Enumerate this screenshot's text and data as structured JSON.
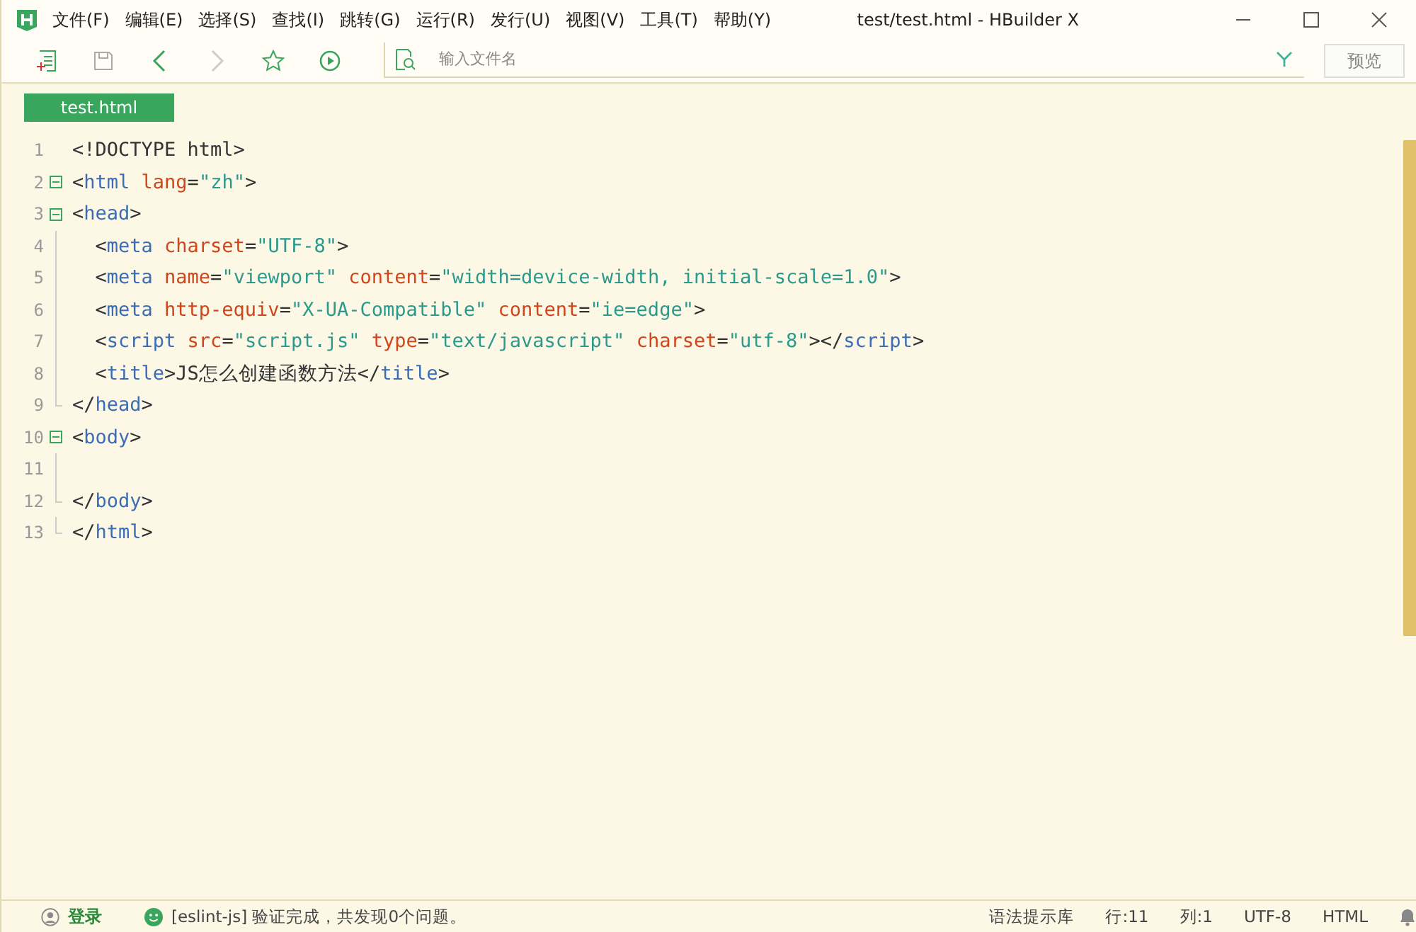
{
  "window": {
    "title": "test/test.html - HBuilder X"
  },
  "menu": [
    "文件(F)",
    "编辑(E)",
    "选择(S)",
    "查找(I)",
    "跳转(G)",
    "运行(R)",
    "发行(U)",
    "视图(V)",
    "工具(T)",
    "帮助(Y)"
  ],
  "toolbar": {
    "search": {
      "placeholder": "输入文件名"
    },
    "preview_button": "预览"
  },
  "tabs": [
    {
      "label": "test.html",
      "selected": true
    }
  ],
  "editor": {
    "lines": [
      {
        "number": "1",
        "kind": "plain",
        "tokens": [
          {
            "kind": "punct",
            "text": "<!DOCTYPE html>"
          }
        ]
      },
      {
        "number": "2",
        "kind": "foldable",
        "tokens": [
          {
            "kind": "punct",
            "text": "<"
          },
          {
            "kind": "tag",
            "text": "html"
          },
          {
            "kind": "attr",
            "text": " lang"
          },
          {
            "kind": "punct",
            "text": "="
          },
          {
            "kind": "str",
            "text": "\"zh\""
          },
          {
            "kind": "punct",
            "text": ">"
          }
        ]
      },
      {
        "number": "3",
        "kind": "foldable",
        "tokens": [
          {
            "kind": "punct",
            "text": "<"
          },
          {
            "kind": "tag",
            "text": "head"
          },
          {
            "kind": "punct",
            "text": ">"
          }
        ]
      },
      {
        "number": "4",
        "kind": "nested",
        "tokens": [
          {
            "kind": "punct",
            "text": "  <"
          },
          {
            "kind": "tag",
            "text": "meta"
          },
          {
            "kind": "attr",
            "text": " charset"
          },
          {
            "kind": "punct",
            "text": "="
          },
          {
            "kind": "str",
            "text": "\"UTF-8\""
          },
          {
            "kind": "punct",
            "text": ">"
          }
        ]
      },
      {
        "number": "5",
        "kind": "nested",
        "tokens": [
          {
            "kind": "punct",
            "text": "  <"
          },
          {
            "kind": "tag",
            "text": "meta"
          },
          {
            "kind": "attr",
            "text": " name"
          },
          {
            "kind": "punct",
            "text": "="
          },
          {
            "kind": "str",
            "text": "\"viewport\""
          },
          {
            "kind": "attr",
            "text": " content"
          },
          {
            "kind": "punct",
            "text": "="
          },
          {
            "kind": "str",
            "text": "\"width=device-width, initial-scale=1.0\""
          },
          {
            "kind": "punct",
            "text": ">"
          }
        ]
      },
      {
        "number": "6",
        "kind": "nested",
        "tokens": [
          {
            "kind": "punct",
            "text": "  <"
          },
          {
            "kind": "tag",
            "text": "meta"
          },
          {
            "kind": "attr",
            "text": " http-equiv"
          },
          {
            "kind": "punct",
            "text": "="
          },
          {
            "kind": "str",
            "text": "\"X-UA-Compatible\""
          },
          {
            "kind": "attr",
            "text": " content"
          },
          {
            "kind": "punct",
            "text": "="
          },
          {
            "kind": "str",
            "text": "\"ie=edge\""
          },
          {
            "kind": "punct",
            "text": ">"
          }
        ]
      },
      {
        "number": "7",
        "kind": "nested",
        "tokens": [
          {
            "kind": "punct",
            "text": "  <"
          },
          {
            "kind": "tag",
            "text": "script"
          },
          {
            "kind": "attr",
            "text": " src"
          },
          {
            "kind": "punct",
            "text": "="
          },
          {
            "kind": "str",
            "text": "\"script.js\""
          },
          {
            "kind": "attr",
            "text": " type"
          },
          {
            "kind": "punct",
            "text": "="
          },
          {
            "kind": "str",
            "text": "\"text/javascript\""
          },
          {
            "kind": "attr",
            "text": " charset"
          },
          {
            "kind": "punct",
            "text": "="
          },
          {
            "kind": "str",
            "text": "\"utf-8\""
          },
          {
            "kind": "punct",
            "text": "></"
          },
          {
            "kind": "tag",
            "text": "script"
          },
          {
            "kind": "punct",
            "text": ">"
          }
        ]
      },
      {
        "number": "8",
        "kind": "nested",
        "tokens": [
          {
            "kind": "punct",
            "text": "  <"
          },
          {
            "kind": "tag",
            "text": "title"
          },
          {
            "kind": "punct",
            "text": ">JS怎么创建函数方法</"
          },
          {
            "kind": "tag",
            "text": "title"
          },
          {
            "kind": "punct",
            "text": ">"
          }
        ]
      },
      {
        "number": "9",
        "kind": "closing",
        "tokens": [
          {
            "kind": "punct",
            "text": "</"
          },
          {
            "kind": "tag",
            "text": "head"
          },
          {
            "kind": "punct",
            "text": ">"
          }
        ]
      },
      {
        "number": "10",
        "kind": "foldable",
        "tokens": [
          {
            "kind": "punct",
            "text": "<"
          },
          {
            "kind": "tag",
            "text": "body"
          },
          {
            "kind": "punct",
            "text": ">"
          }
        ]
      },
      {
        "number": "11",
        "kind": "nested"
      },
      {
        "number": "12",
        "kind": "closing",
        "tokens": [
          {
            "kind": "punct",
            "text": "</"
          },
          {
            "kind": "tag",
            "text": "body"
          },
          {
            "kind": "punct",
            "text": ">"
          }
        ]
      },
      {
        "number": "13",
        "kind": "closing",
        "tokens": [
          {
            "kind": "punct",
            "text": "</"
          },
          {
            "kind": "tag",
            "text": "html"
          },
          {
            "kind": "punct",
            "text": ">"
          }
        ]
      }
    ]
  },
  "status_bar": {
    "login": "登录",
    "lint_message": "[eslint-js] 验证完成，共发现0个问题。",
    "items": [
      "语法提示库",
      "行:11",
      "列:1",
      "UTF-8",
      "HTML"
    ]
  }
}
